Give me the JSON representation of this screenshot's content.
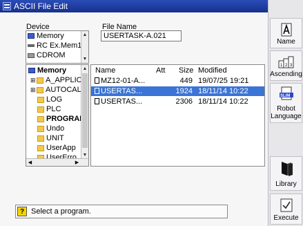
{
  "window": {
    "title": "ASCII File Edit"
  },
  "device": {
    "label": "Device",
    "items": [
      "Memory",
      "RC Ex.Mem1",
      "CDROM"
    ]
  },
  "file_name": {
    "label": "File Name",
    "value": "USERTASK-A.021"
  },
  "tree": {
    "items": [
      "Memory",
      "A_APPLIC",
      "AUTOCAL",
      "LOG",
      "PLC",
      "PROGRAM",
      "Undo",
      "UNIT",
      "UserApp",
      "UserErro"
    ]
  },
  "file_list": {
    "columns": [
      "Name",
      "Att",
      "Size",
      "Modified"
    ],
    "rows": [
      {
        "name": "MZ12-01-A...",
        "att": "",
        "size": "449",
        "modified": "19/07/25 19:21",
        "selected": false
      },
      {
        "name": "USERTAS...",
        "att": "",
        "size": "1924",
        "modified": "18/11/14 10:22",
        "selected": true
      },
      {
        "name": "USERTAS...",
        "att": "",
        "size": "2306",
        "modified": "18/11/14 10:22",
        "selected": false
      }
    ]
  },
  "status": {
    "message": "Select a program."
  },
  "sidebar": {
    "name_label": "Name",
    "ascending_label": "Ascending",
    "robot_language_label": "Robot Language",
    "library_label": "Library",
    "execute_label": "Execute"
  },
  "colors": {
    "title_bar": "#1f3c9e",
    "selection": "#3a74d6",
    "folder": "#f2c94c",
    "status_icon": "#f4d400"
  }
}
